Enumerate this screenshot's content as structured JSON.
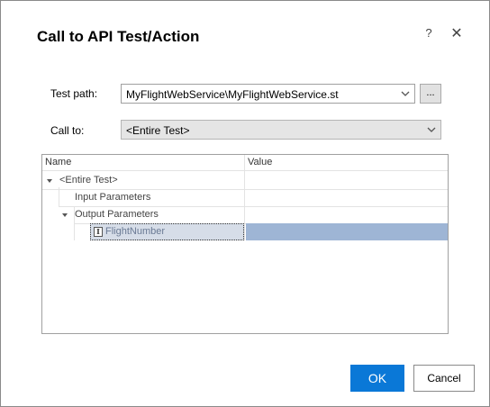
{
  "dialog": {
    "title": "Call to API Test/Action",
    "help_label": "?",
    "close_label": "✕"
  },
  "form": {
    "test_path_label": "Test path:",
    "test_path_value": "MyFlightWebService\\MyFlightWebService.st",
    "browse_label": "...",
    "call_to_label": "Call to:",
    "call_to_value": "<Entire Test>"
  },
  "grid": {
    "columns": [
      "Name",
      "Value"
    ],
    "rows": [
      {
        "name": "<Entire Test>",
        "value": "",
        "expanded": true
      },
      {
        "name": "Input Parameters",
        "value": ""
      },
      {
        "name": "Output Parameters",
        "value": "",
        "expanded": true
      },
      {
        "name": "FlightNumber",
        "value": "",
        "selected": true,
        "icon": "parameter-icon"
      }
    ]
  },
  "buttons": {
    "ok": "OK",
    "cancel": "Cancel"
  },
  "colors": {
    "accent": "#0a78d7",
    "selection": "#9eb5d5"
  }
}
